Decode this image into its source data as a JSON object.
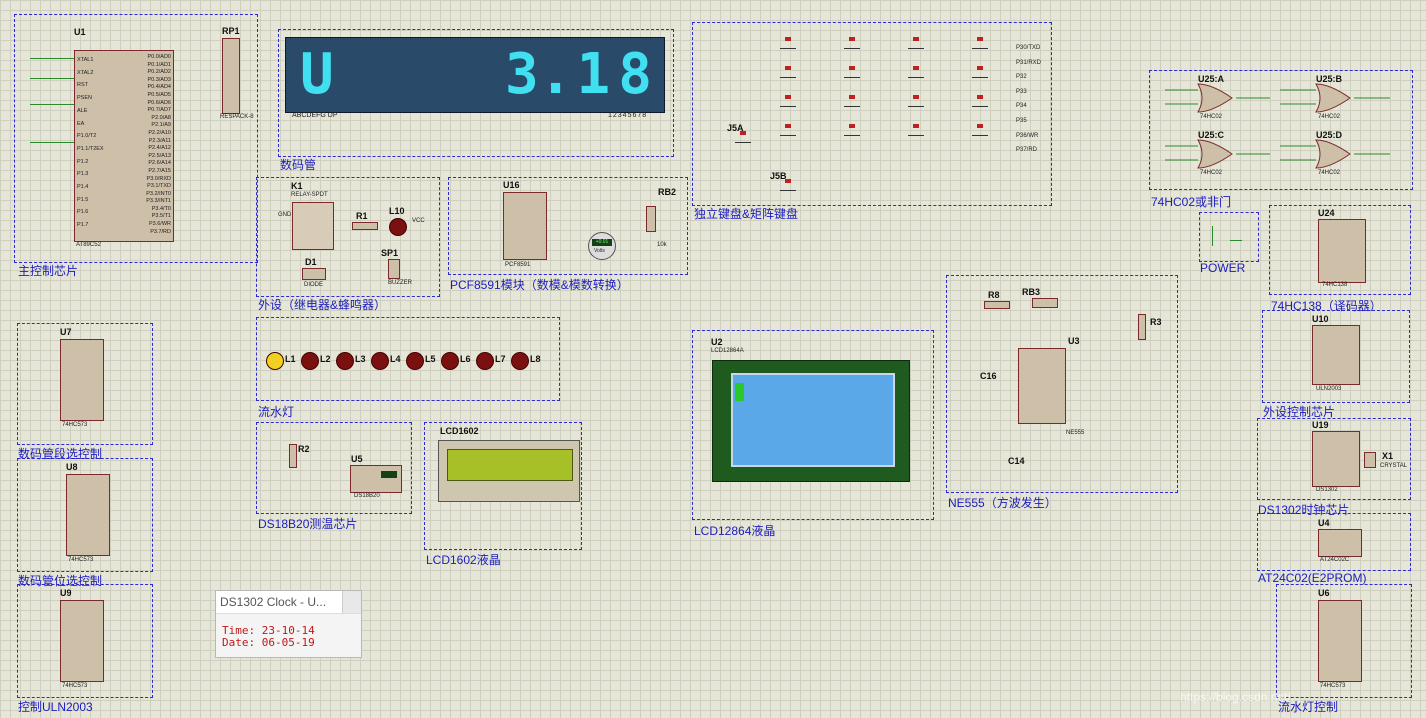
{
  "seven_seg": {
    "chars": [
      "U",
      "",
      "",
      "",
      "",
      "3.",
      "1",
      "8"
    ],
    "pin_labels": "ABCDEFG  DP",
    "digit_labels": "12345678"
  },
  "u1": {
    "ref": "U1",
    "part": "AT89C52",
    "caption": "主控制芯片",
    "rp": "RP1",
    "rp_part": "RESPACK-8",
    "left_pins": [
      "XTAL1",
      "XTAL2",
      "RST",
      "PSEN",
      "ALE",
      "EA",
      "P1.0/T2",
      "P1.1/T2EX",
      "P1.2",
      "P1.3",
      "P1.4",
      "P1.5",
      "P1.6",
      "P1.7"
    ],
    "right_pins": [
      "P0.0/AD0",
      "P0.1/AD1",
      "P0.2/AD2",
      "P0.3/AD3",
      "P0.4/AD4",
      "P0.5/AD5",
      "P0.6/AD6",
      "P0.7/AD7",
      "P2.0/A8",
      "P2.1/A9",
      "P2.2/A10",
      "P2.3/A11",
      "P2.4/A12",
      "P2.5/A13",
      "P2.6/A14",
      "P2.7/A15",
      "P3.0/RXD",
      "P3.1/TXD",
      "P3.2/INT0",
      "P3.3/INT1",
      "P3.4/T0",
      "P3.5/T1",
      "P3.6/WR",
      "P3.7/RD"
    ]
  },
  "captions": {
    "seg": "数码管",
    "peripheral": "外设（继电器&蜂鸣器）",
    "pcf": "PCF8591模块（数模&模数转换）",
    "keys": "独立键盘&矩阵键盘",
    "or_gate": "74HC02或非门",
    "power": "POWER",
    "decoder": "74HC138（译码器）",
    "u7": "数码管段选控制",
    "flow": "流水灯",
    "ne555": "NE555（方波发生）",
    "uln_ctrl": "外设控制芯片",
    "u8": "数码管位选控制",
    "ds18": "DS18B20测温芯片",
    "lcd1602": "LCD1602液晶",
    "lcd12864": "LCD12864液晶",
    "ds1302": "DS1302时钟芯片",
    "u4": "AT24C02(E2PROM)",
    "u9": "控制ULN2003",
    "u6": "流水灯控制"
  },
  "refs": {
    "k1": "K1",
    "k1_part": "RELAY-SPDT",
    "r1": "R1",
    "l10": "L10",
    "d1": "D1",
    "d1_part": "DIODE",
    "sp1": "SP1",
    "sp1_part": "BUZZER",
    "u16": "U16",
    "u16_part": "PCF8591",
    "rb2": "RB2",
    "rb2_val": "10k",
    "volt": "Volts",
    "volt_val": "+0.01",
    "j5a": "J5A",
    "j5b": "J5B",
    "u25a": "U25:A",
    "u25b": "U25:B",
    "u25c": "U25:C",
    "u25d": "U25:D",
    "hc02": "74HC02",
    "u24": "U24",
    "u24_part": "74HC138",
    "u7": "U7",
    "u8": "U8",
    "u9": "U9",
    "u6": "U6",
    "hc573": "74HC573",
    "r8": "R8",
    "rb3": "RB3",
    "r3": "R3",
    "u3": "U3",
    "c16": "C16",
    "c14": "C14",
    "ne555_part": "NE555",
    "u10": "U10",
    "uln": "ULN2003",
    "u19": "U19",
    "ds1302_part": "DS1302",
    "x1": "X1",
    "crystal": "CRYSTAL",
    "u4": "U4",
    "at24": "AT24C02C",
    "r2": "R2",
    "u5": "U5",
    "ds18b20": "DS18B20",
    "lcd1602": "LCD1602",
    "u2": "U2",
    "lcd12864_part": "LCD12864A",
    "leds": [
      "L1",
      "L2",
      "L3",
      "L4",
      "L5",
      "L6",
      "L7",
      "L8"
    ],
    "vcc": "VCC",
    "gnd": "GND",
    "text": "<TEXT>"
  },
  "key_rows": [
    "P30/TXD",
    "P31/RXD",
    "P32",
    "P33",
    "P34",
    "P35",
    "P36/WR",
    "P37/RD"
  ],
  "popup": {
    "title": "DS1302 Clock - U...",
    "time_label": "Time:",
    "time_value": "23-10-14",
    "date_label": "Date:",
    "date_value": "06-05-19"
  },
  "watermark": "https://blog.csdn.net/..."
}
